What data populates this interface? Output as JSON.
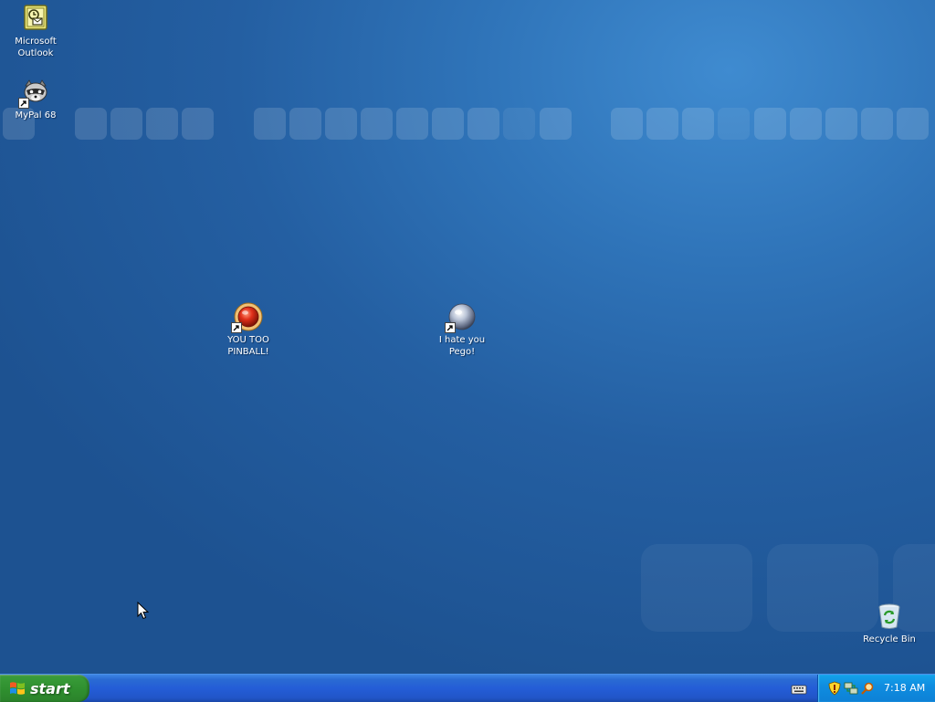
{
  "desktop": {
    "icons": [
      {
        "label": "Microsoft Outlook",
        "icon": "outlook-icon"
      },
      {
        "label": "MyPal 68",
        "icon": "raccoon-icon"
      },
      {
        "label": "YOU TOO PINBALL!",
        "icon": "red-ball-icon"
      },
      {
        "label": "I hate you Pego!",
        "icon": "silver-ball-icon"
      },
      {
        "label": "Recycle Bin",
        "icon": "recycle-bin-icon"
      }
    ]
  },
  "taskbar": {
    "start_label": "start",
    "tray": {
      "icons": [
        "keyboard-icon",
        "security-shield-icon",
        "network-icon",
        "search-icon"
      ],
      "clock": "7:18 AM"
    }
  },
  "colors": {
    "wallpaper": "#2a69ad",
    "taskbar": "#245dd7",
    "start_button": "#2f8f2f",
    "tray": "#0f8de0"
  }
}
